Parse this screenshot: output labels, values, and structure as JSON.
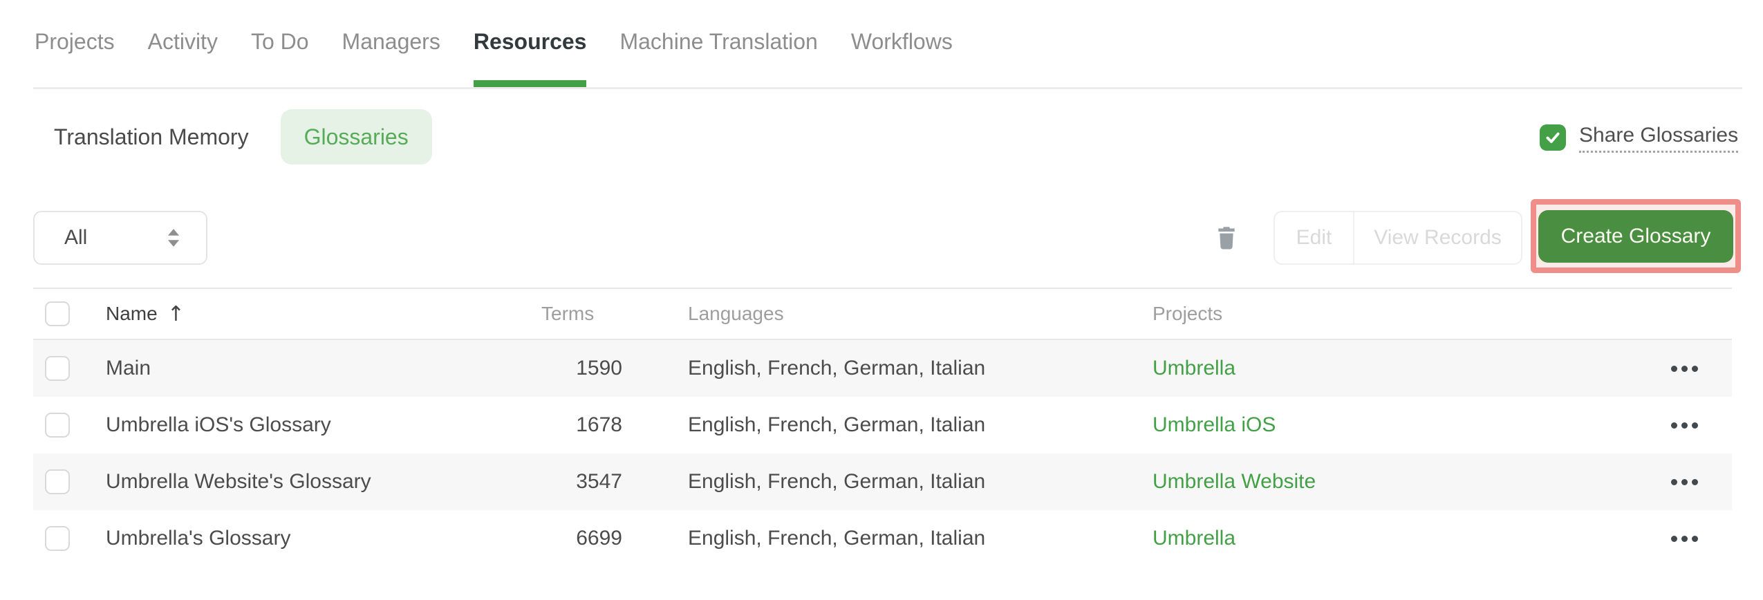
{
  "nav": {
    "items": [
      {
        "label": "Projects",
        "active": false
      },
      {
        "label": "Activity",
        "active": false
      },
      {
        "label": "To Do",
        "active": false
      },
      {
        "label": "Managers",
        "active": false
      },
      {
        "label": "Resources",
        "active": true
      },
      {
        "label": "Machine Translation",
        "active": false
      },
      {
        "label": "Workflows",
        "active": false
      }
    ]
  },
  "subtabs": {
    "translation_memory": "Translation Memory",
    "glossaries": "Glossaries",
    "active": "Glossaries"
  },
  "share": {
    "label": "Share Glossaries",
    "checked": true
  },
  "toolbar": {
    "filter_value": "All",
    "edit_label": "Edit",
    "view_records_label": "View Records",
    "create_label": "Create Glossary",
    "edit_enabled": false,
    "view_records_enabled": false
  },
  "table": {
    "headers": {
      "name": "Name",
      "terms": "Terms",
      "languages": "Languages",
      "projects": "Projects"
    },
    "sort": {
      "column": "Name",
      "direction": "asc"
    },
    "rows": [
      {
        "name": "Main",
        "terms": "1590",
        "languages": "English, French, German, Italian",
        "project": "Umbrella"
      },
      {
        "name": "Umbrella iOS's Glossary",
        "terms": "1678",
        "languages": "English, French, German, Italian",
        "project": "Umbrella iOS"
      },
      {
        "name": "Umbrella Website's Glossary",
        "terms": "3547",
        "languages": "English, French, German, Italian",
        "project": "Umbrella Website"
      },
      {
        "name": "Umbrella's Glossary",
        "terms": "6699",
        "languages": "English, French, German, Italian",
        "project": "Umbrella"
      }
    ]
  },
  "icons": {
    "sort_asc": "↑"
  },
  "colors": {
    "accent_green": "#43a047",
    "button_green": "#4a8e41",
    "pill_bg": "#e5f2e5",
    "pill_text": "#57ab59",
    "highlight_border": "#ef8e88",
    "highlight_bg": "#fbeae8",
    "row_alt_bg": "#f7f7f7",
    "disabled_text": "#d9d9d9",
    "muted_text": "#9e9e9e"
  }
}
